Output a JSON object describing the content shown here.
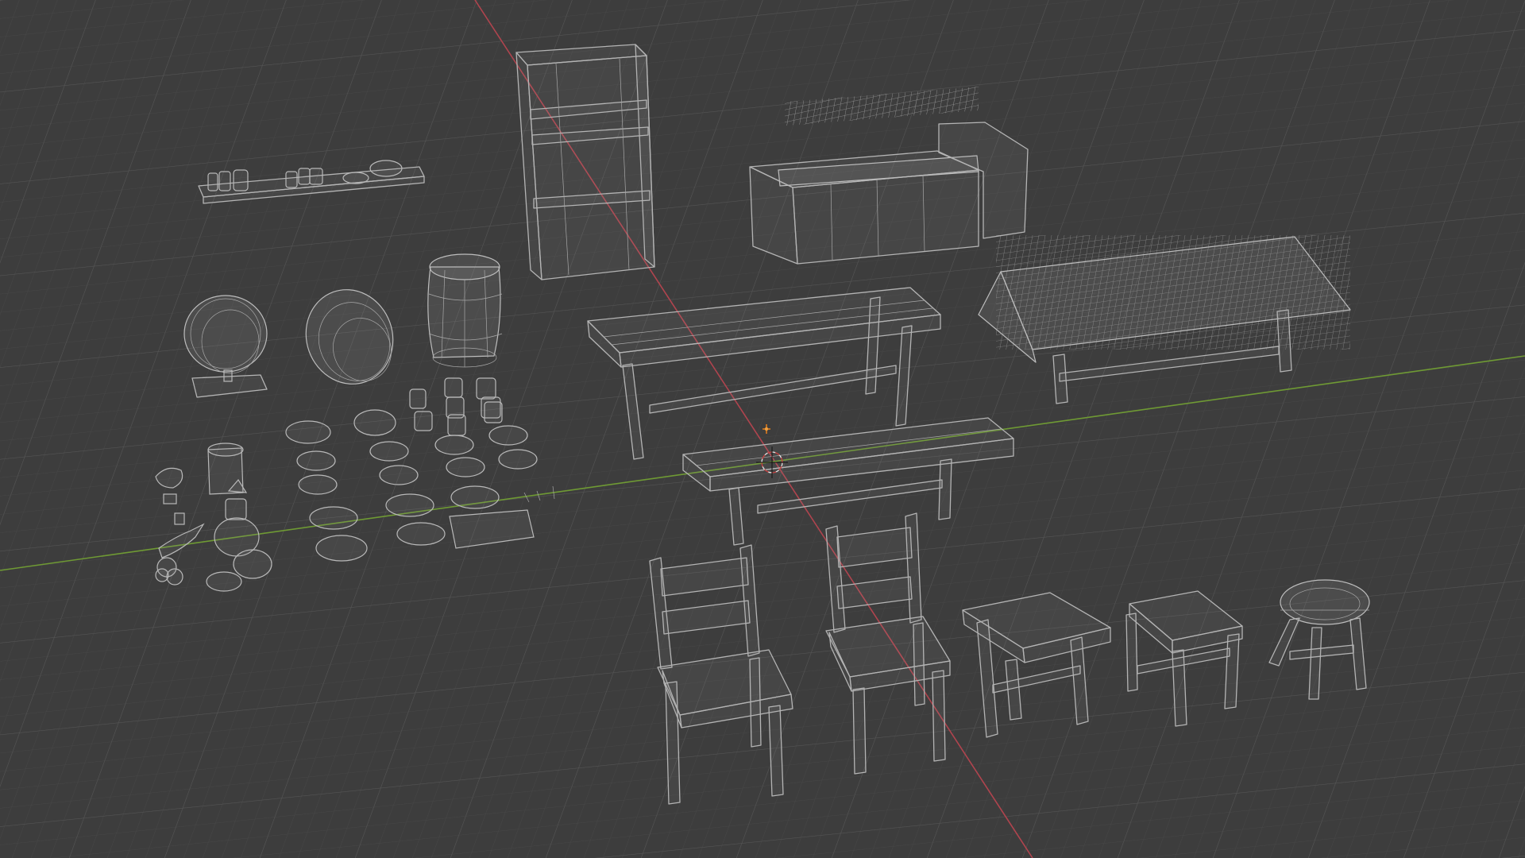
{
  "app": "3D Viewport",
  "view": {
    "shading": "wireframe",
    "grid": true
  },
  "colors": {
    "background": "#3d3d3d",
    "grid_minor": "#464646",
    "grid_major": "#525252",
    "x_axis": "#b0444e",
    "y_axis": "#6f9a34",
    "wire": "#b4b4b4",
    "origin": "#e07b1b"
  },
  "objects": [
    "shelf-with-mugs",
    "bookcase",
    "bar-counter",
    "barrel-on-stand",
    "barrel-tilted",
    "barrel-upright",
    "bench-long",
    "table-with-tablecloth",
    "bench-front",
    "chair-left",
    "chair-right",
    "stool-bench-small",
    "stool-square",
    "stool-round",
    "mugs-cluster",
    "bowls-and-plates",
    "food-props"
  ]
}
